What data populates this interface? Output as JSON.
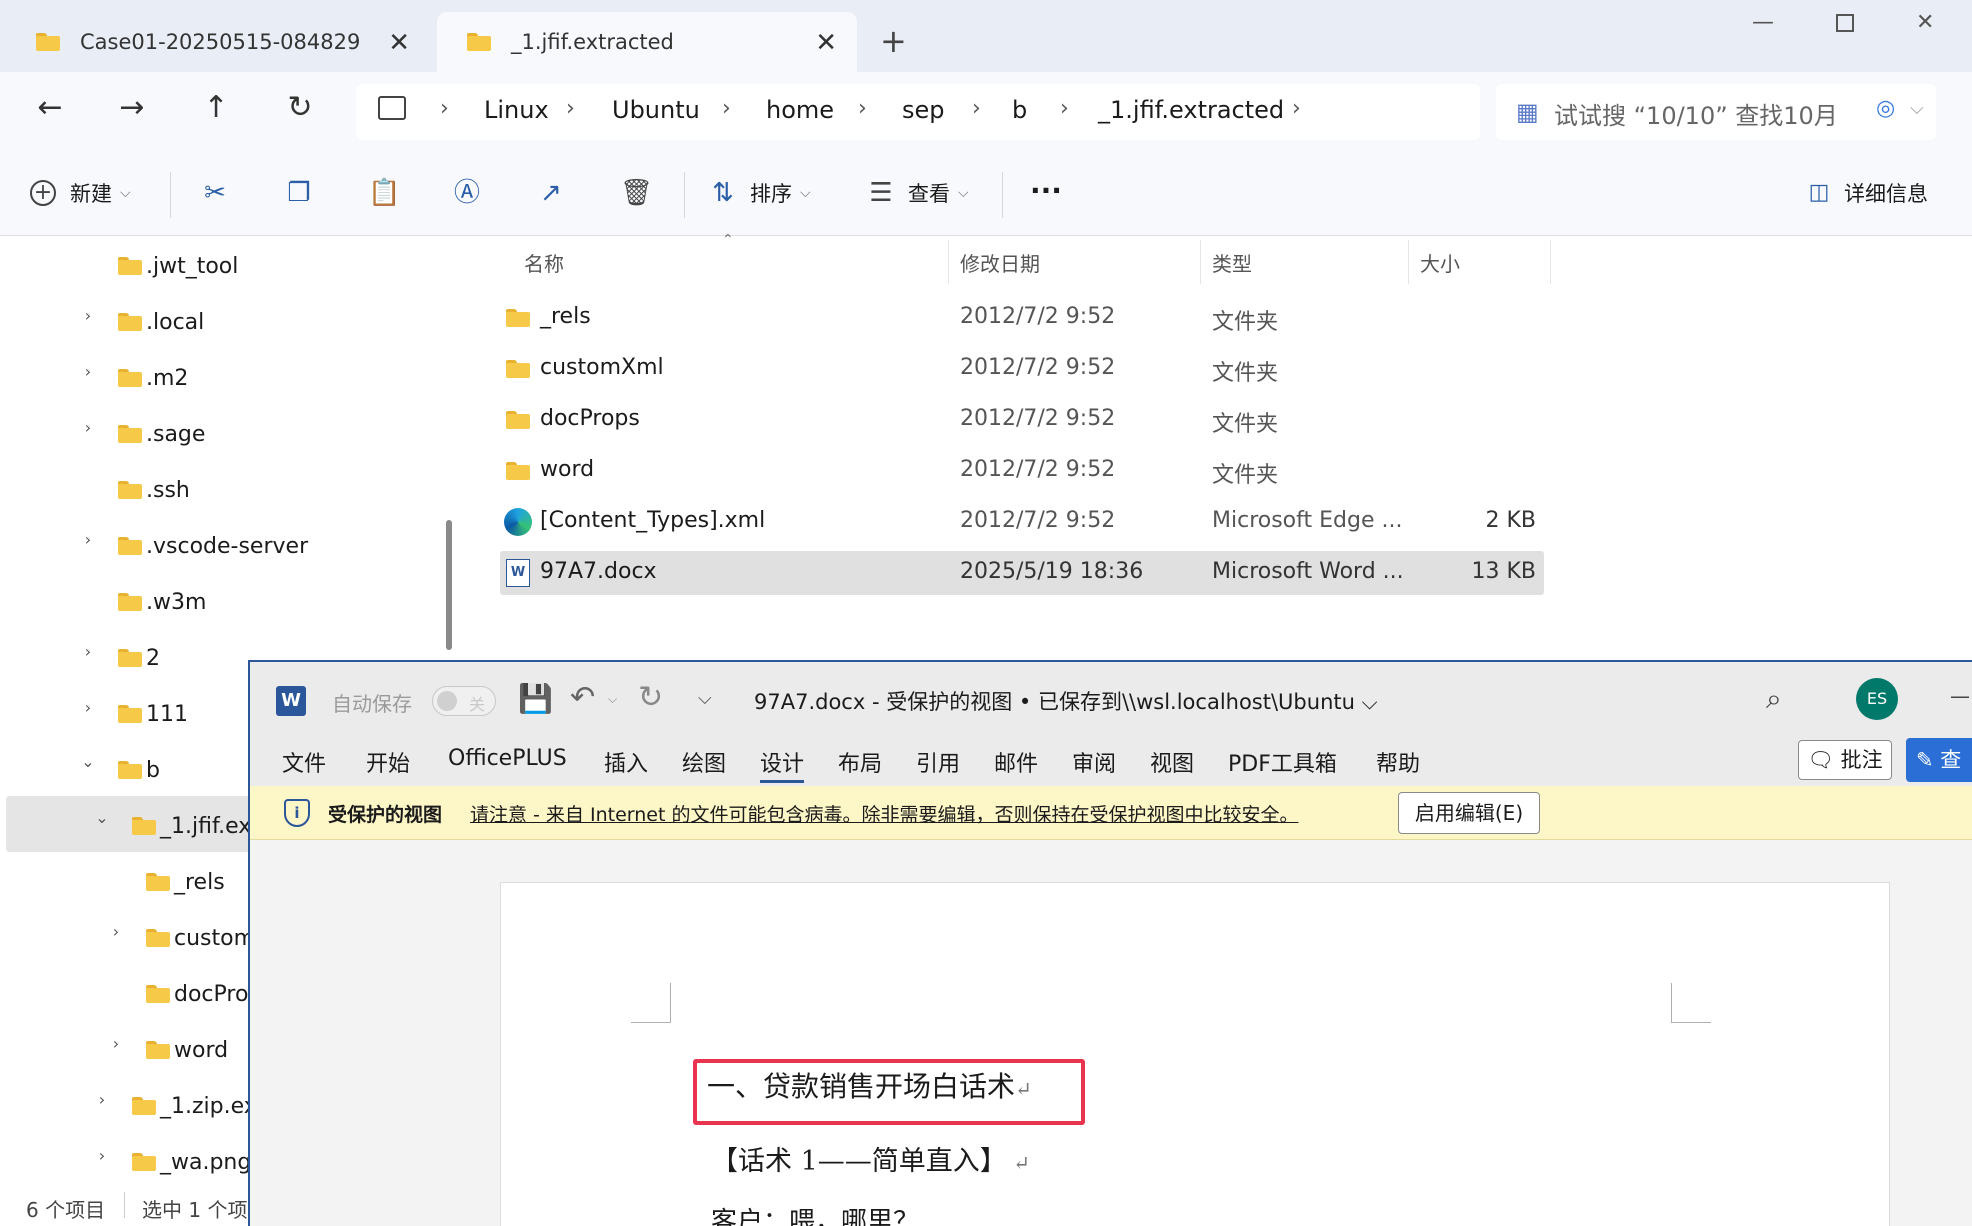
{
  "tabs": [
    {
      "label": "Case01-20250515-084829"
    },
    {
      "label": "_1.jfif.extracted"
    }
  ],
  "breadcrumb": [
    "Linux",
    "Ubuntu",
    "home",
    "sep",
    "b",
    "_1.jfif.extracted"
  ],
  "search": {
    "placeholder": "试试搜 “10/10” 查找10月"
  },
  "toolbar": {
    "new_label": "新建",
    "sort_label": "排序",
    "view_label": "查看",
    "more_label": "···",
    "details_label": "详细信息"
  },
  "tree": [
    {
      "label": ".jwt_tool",
      "expandable": false
    },
    {
      "label": ".local",
      "expandable": true
    },
    {
      "label": ".m2",
      "expandable": true
    },
    {
      "label": ".sage",
      "expandable": true
    },
    {
      "label": ".ssh",
      "expandable": false
    },
    {
      "label": ".vscode-server",
      "expandable": true
    },
    {
      "label": ".w3m",
      "expandable": false
    },
    {
      "label": "2",
      "expandable": true
    },
    {
      "label": "111",
      "expandable": true
    },
    {
      "label": "b",
      "expanded": true
    },
    {
      "label": "_1.jfif.ex",
      "expanded": true,
      "selected": true
    },
    {
      "label": "_rels",
      "expandable": false
    },
    {
      "label": "custom",
      "expandable": true
    },
    {
      "label": "docPro",
      "expandable": false
    },
    {
      "label": "word",
      "expandable": true
    },
    {
      "label": "_1.zip.ex",
      "expandable": true
    },
    {
      "label": "_wa.png",
      "expandable": true
    }
  ],
  "status": {
    "count": "6 个项目",
    "selected": "选中 1 个项"
  },
  "columns": [
    "名称",
    "修改日期",
    "类型",
    "大小"
  ],
  "files": [
    {
      "name": "_rels",
      "date": "2012/7/2 9:52",
      "type": "文件夹",
      "size": "",
      "icon": "folder-icon"
    },
    {
      "name": "customXml",
      "date": "2012/7/2 9:52",
      "type": "文件夹",
      "size": "",
      "icon": "folder-icon"
    },
    {
      "name": "docProps",
      "date": "2012/7/2 9:52",
      "type": "文件夹",
      "size": "",
      "icon": "folder-icon"
    },
    {
      "name": "word",
      "date": "2012/7/2 9:52",
      "type": "文件夹",
      "size": "",
      "icon": "folder-icon"
    },
    {
      "name": "[Content_Types].xml",
      "date": "2012/7/2 9:52",
      "type": "Microsoft Edge ...",
      "size": "2 KB",
      "icon": "edge-icon"
    },
    {
      "name": "97A7.docx",
      "date": "2025/5/19 18:36",
      "type": "Microsoft Word ...",
      "size": "13 KB",
      "icon": "word-doc-icon",
      "selected": true
    }
  ],
  "word": {
    "logo": "W",
    "autosave_label": "自动保存",
    "autosave_state": "关",
    "title": "97A7.docx  -  受保护的视图 • 已保存到\\\\wsl.localhost\\Ubuntu ⌵",
    "avatar": "ES",
    "menu": [
      "文件",
      "开始",
      "OfficePLUS",
      "插入",
      "绘图",
      "设计",
      "布局",
      "引用",
      "邮件",
      "审阅",
      "视图",
      "PDF工具箱",
      "帮助"
    ],
    "comment_label": "批注",
    "edit_label": "查",
    "protected_view": {
      "title": "受保护的视图",
      "message": "请注意 - 来自 Internet 的文件可能包含病毒。除非需要编辑，否则保持在受保护视图中比较安全。",
      "button": "启用编辑(E)"
    },
    "document": {
      "heading": "一、贷款销售开场白话术",
      "line2": "【话术 1——简单直入】",
      "line3": "客户：喂，哪里？"
    }
  },
  "colors": {
    "accent": "#2b579a",
    "highlight": "#e8344e",
    "folder": "#f7c948"
  }
}
